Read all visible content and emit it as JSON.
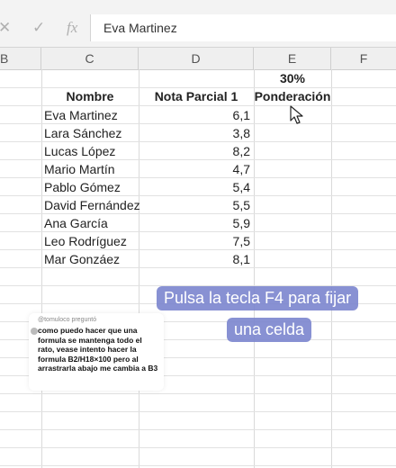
{
  "formula_bar": {
    "cancel_icon": "close-x-icon",
    "enter_icon": "check-icon",
    "function_label": "fx",
    "value": "Eva Martinez"
  },
  "columns": [
    "B",
    "C",
    "D",
    "E",
    "F"
  ],
  "sheet": {
    "weight": "30%",
    "headers": {
      "name": "Nombre",
      "grade": "Nota Parcial 1",
      "weighting": "Ponderación"
    },
    "rows": [
      {
        "name": "Eva Martinez",
        "grade": "6,1"
      },
      {
        "name": "Lara Sánchez",
        "grade": "3,8"
      },
      {
        "name": "Lucas López",
        "grade": "8,2"
      },
      {
        "name": "Mario Martín",
        "grade": "4,7"
      },
      {
        "name": "Pablo Gómez",
        "grade": "5,4"
      },
      {
        "name": "David Fernández",
        "grade": "5,5"
      },
      {
        "name": "Ana García",
        "grade": "5,9"
      },
      {
        "name": "Leo Rodríguez",
        "grade": "7,5"
      },
      {
        "name": "Mar Gonzáez",
        "grade": "8,1"
      }
    ]
  },
  "comment": {
    "header": "@tomuloco preguntó",
    "text": "como puedo hacer que una formula se mantenga todo el rato, vease intento hacer la formula B2/H18×100 pero al arrastrarla abajo me cambia a B3"
  },
  "caption": {
    "line1": "Pulsa la tecla F4 para fijar",
    "line2": "una celda"
  }
}
